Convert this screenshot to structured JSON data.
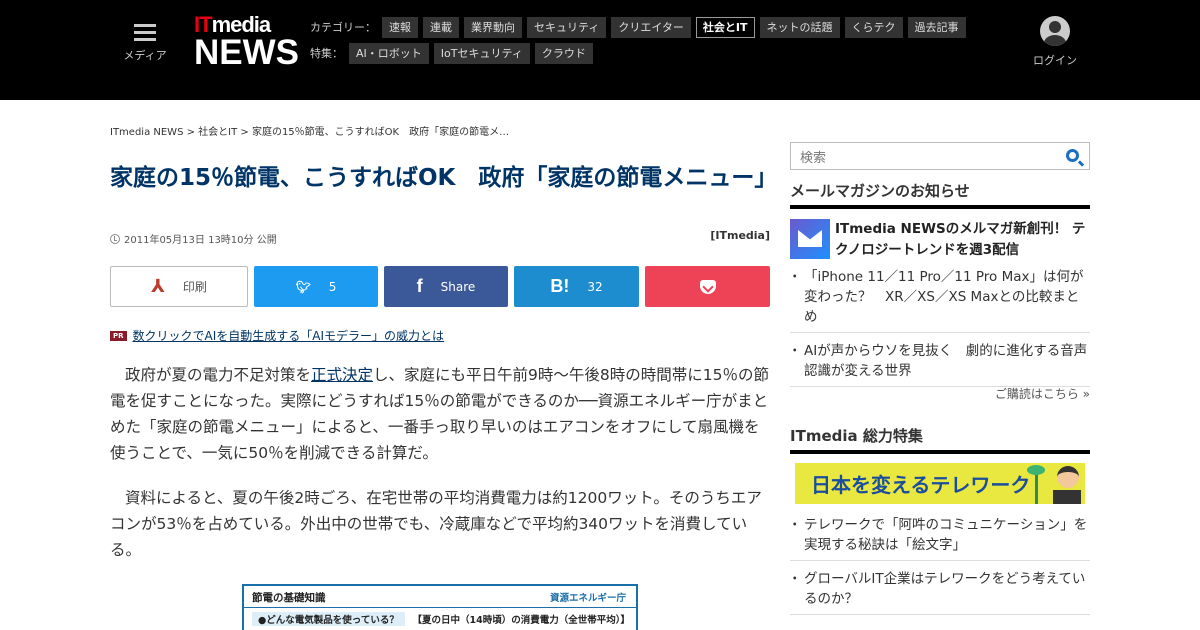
{
  "header": {
    "menu_label": "メディア",
    "logo_it": "IT",
    "logo_media": "media",
    "logo_news": "NEWS",
    "category_head": "カテゴリー：",
    "categories": [
      "速報",
      "連載",
      "業界動向",
      "セキュリティ",
      "クリエイター",
      "社会とIT",
      "ネットの話題",
      "くらテク",
      "過去記事"
    ],
    "active_category": "社会とIT",
    "feature_head": "特集：",
    "features": [
      "AI・ロボット",
      "IoTセキュリティ",
      "クラウド"
    ],
    "login_label": "ログイン"
  },
  "article": {
    "breadcrumb": "ITmedia NEWS > 社会とIT > 家庭の15％節電、こうすればOK　政府「家庭の節電メ…",
    "title": "家庭の15％節電、こうすればOK　政府「家庭の節電メニュー」",
    "date": "2011年05月13日 13時10分 公開",
    "source": "[ITmedia]",
    "share": {
      "print": "印刷",
      "twitter_count": "5",
      "facebook": "Share",
      "hatena_count": "32"
    },
    "pr_badge": "PR",
    "pr_link": "数クリックでAIを自動生成する「AIモデラー」の威力とは",
    "p1_before": "政府が夏の電力不足対策を",
    "p1_link": "正式決定",
    "p1_after": "し、家庭にも平日午前9時～午後8時の時間帯に15％の節電を促すことになった。実際にどうすれば15％の節電ができるのか──資源エネルギー庁がまとめた「家庭の節電メニュー」によると、一番手っ取り早いのはエアコンをオフにして扇風機を使うことで、一気に50％を削減できる計算だ。",
    "p2": "資料によると、夏の午後2時ごろ、在宅世帯の平均消費電力は約1200ワット。そのうちエアコンが53％を占めている。外出中の世帯でも、冷蔵庫などで平均約340ワットを消費している。",
    "figure": {
      "title": "節電の基礎知識",
      "agency": "資源エネルギー庁",
      "question": "●どんな電気製品を使っている？",
      "caption": "【夏の日中（14時頃）の消費電力（全世帯平均）】"
    }
  },
  "sidebar": {
    "search_placeholder": "検索",
    "newsletter_title": "メールマガジンのお知らせ",
    "newsletter_feature": "ITmedia NEWSのメルマガ新創刊！ テクノロジートレンドを週3配信",
    "newsletter_items": [
      "「iPhone 11／11 Pro／11 Pro Max」は何が変わった？　XR／XS／XS Maxとの比較まとめ",
      "AIが声からウソを見抜く　劇的に進化する音声認識が変える世界"
    ],
    "subscribe_link": "ご購読はこちら »",
    "special_title": "ITmedia 総力特集",
    "banner_text": "日本を変えるテレワーク",
    "special_items": [
      "テレワークで「阿吽のコミュニケーション」を実現する秘訣は「絵文字」",
      "グローバルIT企業はテレワークをどう考えているのか？"
    ]
  },
  "colors": {
    "header_bg": "#000000",
    "title_color": "#003366",
    "twitter": "#1d9bf0",
    "facebook": "#3b5998",
    "hatena": "#1d8dcf",
    "pocket": "#ee4256"
  }
}
